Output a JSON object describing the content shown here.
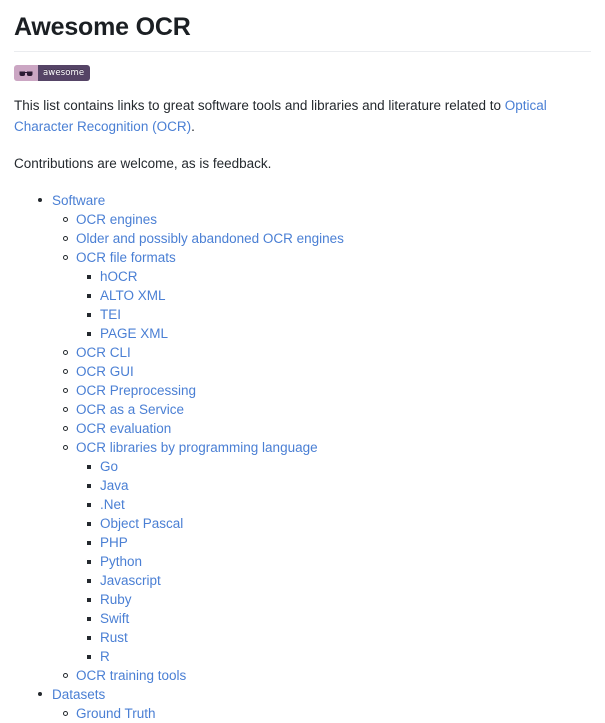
{
  "page": {
    "title": "Awesome OCR",
    "badge": {
      "icon": "sunglasses-icon",
      "label": "awesome",
      "left_color": "#cba6c3",
      "right_color": "#554466"
    },
    "link_color": "#4a7fd4",
    "text_color": "#24292e",
    "paragraphs": [
      {
        "parts": [
          {
            "type": "text",
            "value": "This list contains links to great software tools and libraries and literature related to "
          },
          {
            "type": "link",
            "value": "Optical Character Recognition (OCR)"
          },
          {
            "type": "text",
            "value": "."
          }
        ]
      },
      {
        "parts": [
          {
            "type": "text",
            "value": "Contributions are welcome, as is feedback."
          }
        ]
      }
    ],
    "toc": [
      {
        "label": "Software",
        "children": [
          {
            "label": "OCR engines"
          },
          {
            "label": "Older and possibly abandoned OCR engines"
          },
          {
            "label": "OCR file formats",
            "children": [
              {
                "label": "hOCR"
              },
              {
                "label": "ALTO XML"
              },
              {
                "label": "TEI"
              },
              {
                "label": "PAGE XML"
              }
            ]
          },
          {
            "label": "OCR CLI"
          },
          {
            "label": "OCR GUI"
          },
          {
            "label": "OCR Preprocessing"
          },
          {
            "label": "OCR as a Service"
          },
          {
            "label": "OCR evaluation"
          },
          {
            "label": "OCR libraries by programming language",
            "children": [
              {
                "label": "Go"
              },
              {
                "label": "Java"
              },
              {
                "label": ".Net"
              },
              {
                "label": "Object Pascal"
              },
              {
                "label": "PHP"
              },
              {
                "label": "Python"
              },
              {
                "label": "Javascript"
              },
              {
                "label": "Ruby"
              },
              {
                "label": "Swift"
              },
              {
                "label": "Rust"
              },
              {
                "label": "R"
              }
            ]
          },
          {
            "label": "OCR training tools"
          }
        ]
      },
      {
        "label": "Datasets",
        "children": [
          {
            "label": "Ground Truth"
          }
        ]
      }
    ]
  }
}
